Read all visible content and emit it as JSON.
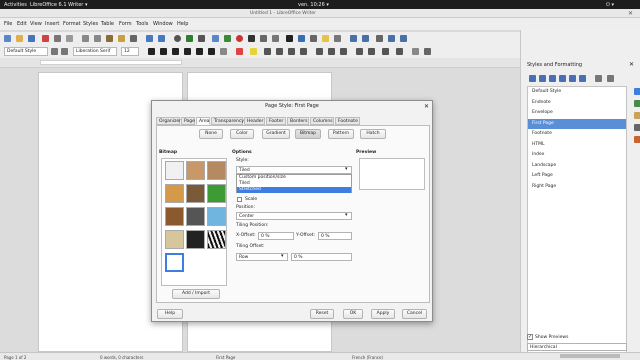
{
  "topbar": {
    "activities": "Activities",
    "app": "LibreOffice 6.1 Writer ▾",
    "clock": "ven. 10:26 ▾"
  },
  "window": {
    "title": "Untitled 1 - LibreOffice Writer"
  },
  "menu": [
    "File",
    "Edit",
    "View",
    "Insert",
    "Format",
    "Styles",
    "Table",
    "Form",
    "Tools",
    "Window",
    "Help"
  ],
  "toolbar": {
    "para_style": "Default Style",
    "font": "Liberation Serif",
    "size": "12"
  },
  "dialog": {
    "title": "Page Style: First Page",
    "tabs": [
      "Organizer",
      "Page",
      "Area",
      "Transparency",
      "Header",
      "Footer",
      "Borders",
      "Columns",
      "Footnote"
    ],
    "fill_buttons": [
      "None",
      "Color",
      "Gradient",
      "Bitmap",
      "Pattern",
      "Hatch"
    ],
    "bitmap_heading": "Bitmap",
    "add_import": "Add / Import",
    "options_heading": "Options",
    "style_label": "Style:",
    "style_value": "Tiled",
    "style_options": [
      "Custom position/size",
      "Tiled",
      "Stretched"
    ],
    "scale_label": "Scale",
    "position_label": "Position:",
    "position_value": "Center",
    "tiling_position_label": "Tiling Position:",
    "x_offset_label": "X-Offset:",
    "x_offset_value": "0 %",
    "y_offset_label": "Y-Offset:",
    "y_offset_value": "0 %",
    "tiling_offset_label": "Tiling Offset:",
    "tiling_offset_mode": "Row",
    "tiling_offset_value": "0 %",
    "preview_heading": "Preview",
    "help": "Help",
    "reset": "Reset",
    "ok": "OK",
    "apply": "Apply",
    "cancel": "Cancel"
  },
  "sidebar": {
    "title": "Styles and Formatting",
    "items": [
      "Default Style",
      "Endnote",
      "Envelope",
      "First Page",
      "Footnote",
      "HTML",
      "Index",
      "Landscape",
      "Left Page",
      "Right Page"
    ],
    "selected_index": 3,
    "show_previews": "Show Previews",
    "filter": "Hierarchical"
  },
  "status": {
    "page": "Page 1 of 2",
    "words": "0 words, 0 characters",
    "style": "First Page",
    "lang": "French (France)"
  },
  "colors": {
    "accent": "#3d7ee0",
    "selected_item": "#5a8ed6",
    "topbar": "#1d1d1d"
  }
}
